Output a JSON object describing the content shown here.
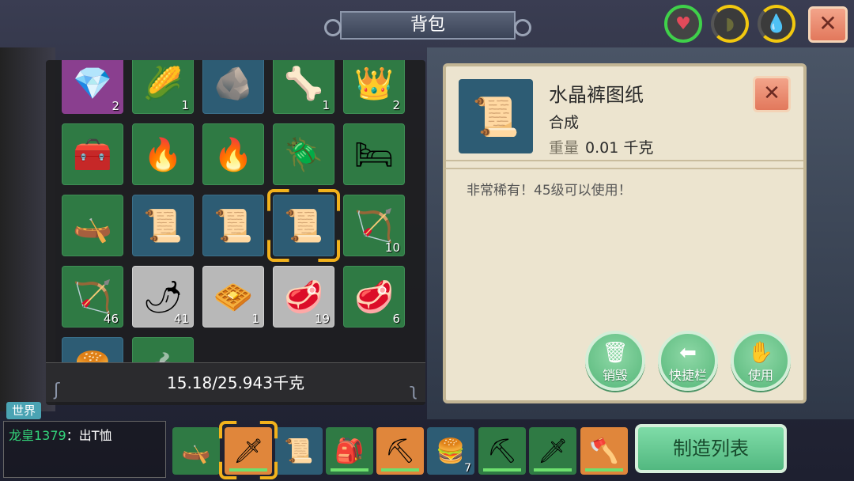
{
  "title": "背包",
  "status": {
    "heart_icon": "heart-icon",
    "food_icon": "food-icon",
    "water_icon": "water-icon"
  },
  "close_label": "✕",
  "inventory": {
    "slots": [
      {
        "icon": "💎",
        "count": "2",
        "bg": "purple"
      },
      {
        "icon": "🌽",
        "count": "1",
        "bg": "green"
      },
      {
        "icon": "🪨",
        "count": "",
        "bg": "blue"
      },
      {
        "icon": "🦴",
        "count": "1",
        "bg": "green"
      },
      {
        "icon": "👑",
        "count": "2",
        "bg": "green"
      },
      {
        "icon": "🧰",
        "count": "",
        "bg": "green"
      },
      {
        "icon": "🔥",
        "count": "",
        "bg": "green"
      },
      {
        "icon": "🔥",
        "count": "",
        "bg": "green"
      },
      {
        "icon": "🪲",
        "count": "",
        "bg": "green"
      },
      {
        "icon": "🛏",
        "count": "",
        "bg": "green"
      },
      {
        "icon": "🛶",
        "count": "",
        "bg": "green"
      },
      {
        "icon": "📜",
        "count": "",
        "bg": "blue"
      },
      {
        "icon": "📜",
        "count": "",
        "bg": "blue"
      },
      {
        "icon": "📜",
        "count": "",
        "bg": "blue"
      },
      {
        "icon": "🏹",
        "count": "10",
        "bg": "green"
      },
      {
        "icon": "🏹",
        "count": "46",
        "bg": "green"
      },
      {
        "icon": "🌶",
        "count": "41",
        "bg": "gray"
      },
      {
        "icon": "🧇",
        "count": "1",
        "bg": "gray"
      },
      {
        "icon": "🥩",
        "count": "19",
        "bg": "gray"
      },
      {
        "icon": "🥩",
        "count": "6",
        "bg": "green"
      },
      {
        "icon": "🍔",
        "count": "",
        "bg": "blue"
      },
      {
        "icon": "🍲",
        "count": "",
        "bg": "green"
      }
    ],
    "weight_text": "15.18/25.943千克"
  },
  "detail": {
    "name": "水晶裤图纸",
    "category": "合成",
    "weight_label": "重量",
    "weight_value": "0.01 千克",
    "description": "非常稀有！45级可以使用！",
    "actions": [
      {
        "icon": "🗑",
        "label": "销毁"
      },
      {
        "icon": "➜",
        "label": "快捷栏"
      },
      {
        "icon": "✋",
        "label": "使用"
      }
    ]
  },
  "chat": {
    "tag": "世界",
    "user": "龙皇1379",
    "message": "：出T恤"
  },
  "hotbar": [
    {
      "icon": "🛶",
      "bg": "green",
      "count": "",
      "durability": false
    },
    {
      "icon": "🗡",
      "bg": "orange",
      "count": "",
      "durability": true
    },
    {
      "icon": "📜",
      "bg": "blue",
      "count": "",
      "durability": false
    },
    {
      "icon": "🎒",
      "bg": "green",
      "count": "",
      "durability": true
    },
    {
      "icon": "⛏",
      "bg": "orange",
      "count": "",
      "durability": true
    },
    {
      "icon": "🍔",
      "bg": "blue",
      "count": "7",
      "durability": false
    },
    {
      "icon": "⛏",
      "bg": "green",
      "count": "",
      "durability": true
    },
    {
      "icon": "🗡",
      "bg": "green",
      "count": "",
      "durability": true
    },
    {
      "icon": "🪓",
      "bg": "orange",
      "count": "",
      "durability": true
    }
  ],
  "craft_label": "制造列表"
}
